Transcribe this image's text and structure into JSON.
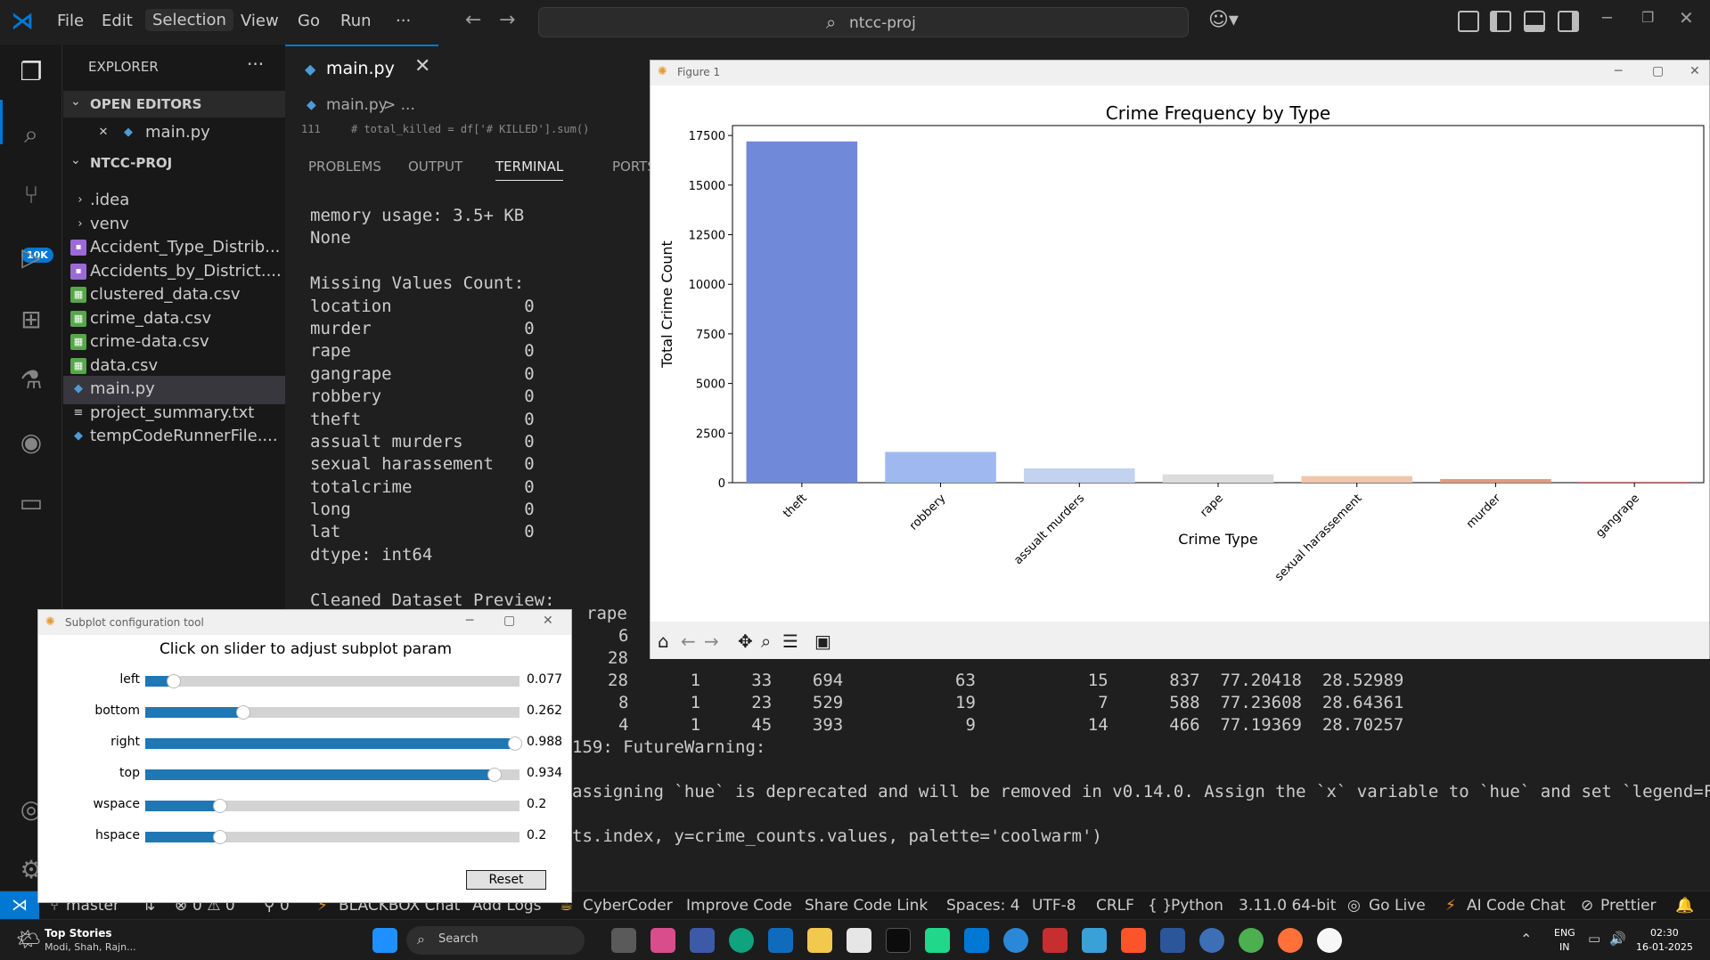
{
  "titlebar": {
    "menus": [
      "File",
      "Edit",
      "Selection",
      "View",
      "Go",
      "Run",
      "···"
    ],
    "search": "ntcc-proj"
  },
  "activity": {
    "badge": "10K"
  },
  "sidebar": {
    "title": "EXPLORER",
    "open_editors_label": "OPEN EDITORS",
    "open_editor_file": "main.py",
    "project_label": "NTCC-PROJ",
    "files": [
      {
        "name": ".idea",
        "type": "folder"
      },
      {
        "name": "venv",
        "type": "folder"
      },
      {
        "name": "Accident_Type_Distrib...",
        "type": "image"
      },
      {
        "name": "Accidents_by_District....",
        "type": "image"
      },
      {
        "name": "clustered_data.csv",
        "type": "csv"
      },
      {
        "name": "crime_data.csv",
        "type": "csv"
      },
      {
        "name": "crime-data.csv",
        "type": "csv"
      },
      {
        "name": "data.csv",
        "type": "csv"
      },
      {
        "name": "main.py",
        "type": "python"
      },
      {
        "name": "project_summary.txt",
        "type": "text"
      },
      {
        "name": "tempCodeRunnerFile....",
        "type": "python"
      }
    ]
  },
  "editor": {
    "tab": "main.py",
    "breadcrumb_file": "main.py",
    "breadcrumb_rest": "> ...",
    "code_line_no": "111",
    "code_line": "# total_killed = df['# KILLED'].sum()",
    "panel_tabs": [
      "PROBLEMS",
      "OUTPUT",
      "TERMINAL",
      "PORTS"
    ],
    "terminal_lines": [
      "memory usage: 3.5+ KB",
      "None",
      "",
      "Missing Values Count:",
      "location             0",
      "murder               0",
      "rape                 0",
      "gangrape             0",
      "robbery              0",
      "theft                0",
      "assualt murders      0",
      "sexual harassement   0",
      "totalcrime           0",
      "long                 0",
      "lat                  0",
      "dtype: int64",
      "",
      "Cleaned Dataset Preview:"
    ],
    "rape_header": "rape",
    "table_rows": [
      {
        "rape": "6",
        "rest": ""
      },
      {
        "rape": "28",
        "rest": ""
      },
      {
        "rape": "28",
        "rest": "      1     33    694           63           15      837  77.20418  28.52989"
      },
      {
        "rape": "8",
        "rest": "      1     23    529           19            7      588  77.23608  28.64361"
      },
      {
        "rape": "4",
        "rest": "      1     45    393            9           14      466  77.19369  28.70257"
      }
    ],
    "warning_line": "159: FutureWarning:",
    "warning_text": "assigning `hue` is deprecated and will be removed in v0.14.0. Assign the `x` variable to `hue` and set `legend=Fals",
    "code_tail": "ts.index, y=crime_counts.values, palette='coolwarm')"
  },
  "statusbar": {
    "branch": "master",
    "problems": "0 ⚠ 0",
    "ports": "0",
    "blackbox": "BLACKBOX Chat",
    "add_logs": "Add Logs",
    "cybercoder": "CyberCoder",
    "improve_code": "Improve Code",
    "share_code": "Share Code Link",
    "spaces": "Spaces: 4",
    "encoding": "UTF-8",
    "eol": "CRLF",
    "language": "Python",
    "python_version": "3.11.0 64-bit",
    "go_live": "Go Live",
    "ai_chat": "AI Code Chat",
    "prettier": "Prettier"
  },
  "taskbar": {
    "news_title": "Top Stories",
    "news_sub": "Modi, Shah, Rajn...",
    "search": "Search",
    "lang": "ENG",
    "region": "IN",
    "time": "02:30",
    "date": "16-01-2025"
  },
  "figure": {
    "window_title": "Figure 1"
  },
  "chart_data": {
    "type": "bar",
    "title": "Crime Frequency by Type",
    "xlabel": "Crime Type",
    "ylabel": "Total Crime Count",
    "categories": [
      "theft",
      "robbery",
      "assualt murders",
      "rape",
      "sexual harassement",
      "murder",
      "gangrape"
    ],
    "values": [
      17200,
      1550,
      720,
      420,
      330,
      180,
      40
    ],
    "colors": [
      "#7089d9",
      "#9fb8f0",
      "#c3d2ef",
      "#dcdcdc",
      "#efc5ad",
      "#e8977c",
      "#c55c4b"
    ],
    "yticks": [
      0,
      2500,
      5000,
      7500,
      10000,
      12500,
      15000,
      17500
    ],
    "ylim": [
      0,
      18000
    ]
  },
  "subplot_tool": {
    "window_title": "Subplot configuration tool",
    "heading": "Click on slider to adjust subplot param",
    "sliders": [
      {
        "label": "left",
        "value": 0.077,
        "display": "0.077"
      },
      {
        "label": "bottom",
        "value": 0.262,
        "display": "0.262"
      },
      {
        "label": "right",
        "value": 0.988,
        "display": "0.988"
      },
      {
        "label": "top",
        "value": 0.934,
        "display": "0.934"
      },
      {
        "label": "wspace",
        "value": 0.2,
        "display": "0.2"
      },
      {
        "label": "hspace",
        "value": 0.2,
        "display": "0.2"
      }
    ],
    "reset_label": "Reset"
  }
}
